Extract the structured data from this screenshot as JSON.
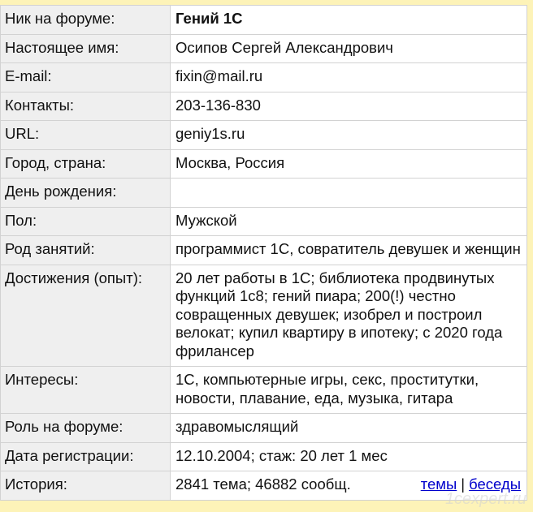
{
  "profile": [
    {
      "label": "Ник на форуме:",
      "value": "Гений 1С",
      "bold": true
    },
    {
      "label": "Настоящее имя:",
      "value": "Осипов Сергей Александрович"
    },
    {
      "label": "E-mail:",
      "value": "fixin@mail.ru"
    },
    {
      "label": "Контакты:",
      "value": "203-136-830"
    },
    {
      "label": "URL:",
      "value": "geniy1s.ru"
    },
    {
      "label": "Город, страна:",
      "value": "Москва, Россия"
    },
    {
      "label": "День рождения:",
      "value": ""
    },
    {
      "label": "Пол:",
      "value": "Мужской"
    },
    {
      "label": "Род занятий:",
      "value": "программист 1С, совратитель девушек и женщин"
    },
    {
      "label": "Достижения (опыт):",
      "value": "20 лет работы в 1С; библиотека продвинутых функций 1с8; гений пиара; 200(!) честно совращенных девушек; изобрел и построил велокат; купил квартиру в ипотеку; с 2020 года фрилансер"
    },
    {
      "label": "Интересы:",
      "value": "1С, компьютерные игры, секс, проститутки, новости, плавание, еда, музыка, гитара"
    },
    {
      "label": "Роль на форуме:",
      "value": "здравомыслящий"
    },
    {
      "label": "Дата регистрации:",
      "value": "12.10.2004; стаж: 20 лет 1 мес"
    }
  ],
  "history": {
    "label": "История:",
    "value": "2841 тема; 46882 сообщ.",
    "link_topics": "темы",
    "separator": "|",
    "link_talks": "беседы"
  },
  "watermark": "1cexpert.ru"
}
